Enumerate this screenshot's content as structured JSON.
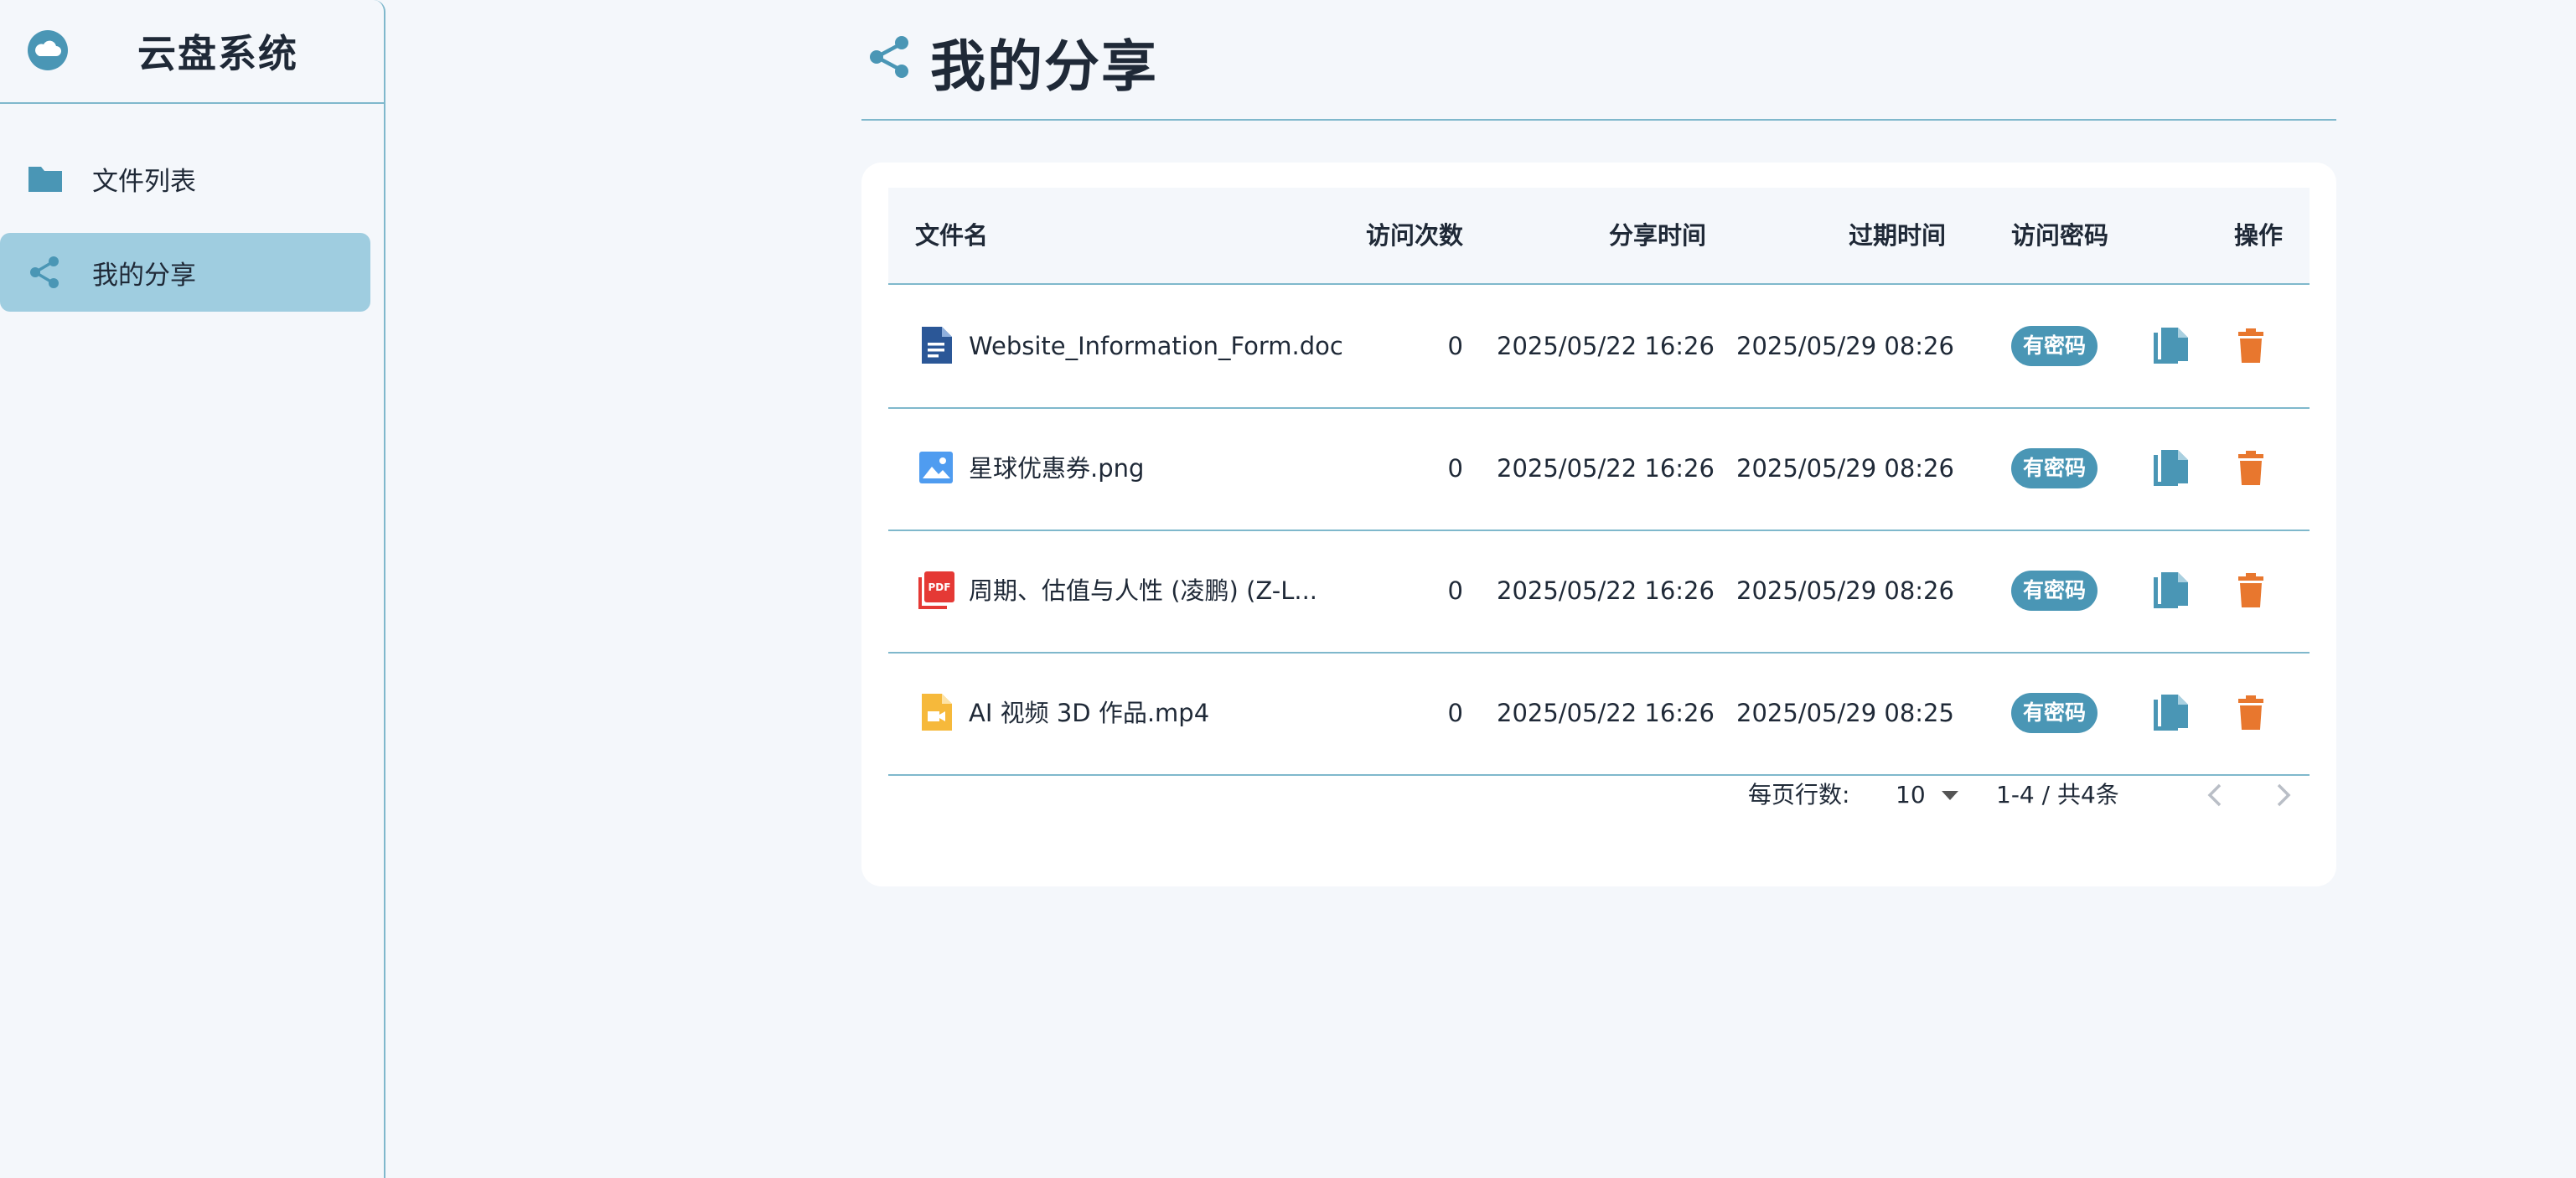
{
  "app": {
    "title": "云盘系统",
    "brand_icon": "cloud-icon"
  },
  "sidebar": {
    "items": [
      {
        "label": "文件列表",
        "icon": "folder-icon",
        "active": false
      },
      {
        "label": "我的分享",
        "icon": "share-icon",
        "active": true
      }
    ]
  },
  "page": {
    "title": "我的分享",
    "icon": "share-icon"
  },
  "table": {
    "columns": [
      "文件名",
      "访问次数",
      "分享时间",
      "过期时间",
      "访问密码",
      "操作"
    ],
    "rows": [
      {
        "name": "Website_Information_Form.doc",
        "type_icon": "doc-file-icon",
        "visits": "0",
        "share_time": "2025/05/22 16:26",
        "expire_time": "2025/05/29 08:26",
        "password": "有密码"
      },
      {
        "name": "星球优惠券.png",
        "type_icon": "image-file-icon",
        "visits": "0",
        "share_time": "2025/05/22 16:26",
        "expire_time": "2025/05/29 08:26",
        "password": "有密码"
      },
      {
        "name": "周期、估值与人性 (凌鹏) (Z-L...",
        "type_icon": "pdf-file-icon",
        "visits": "0",
        "share_time": "2025/05/22 16:26",
        "expire_time": "2025/05/29 08:26",
        "password": "有密码"
      },
      {
        "name": "AI 视频 3D 作品.mp4",
        "type_icon": "video-file-icon",
        "visits": "0",
        "share_time": "2025/05/22 16:26",
        "expire_time": "2025/05/29 08:25",
        "password": "有密码"
      }
    ],
    "row_actions": [
      "copy-icon",
      "delete-icon"
    ]
  },
  "pagination": {
    "rows_per_page_label": "每页行数:",
    "rows_per_page_value": "10",
    "range_text": "1-4 / 共4条"
  },
  "colors": {
    "accent": "#4a96b5",
    "active_nav": "#9fcde0",
    "delete": "#e8772e",
    "divider": "#7fb8cc",
    "background": "#f4f7fb"
  }
}
